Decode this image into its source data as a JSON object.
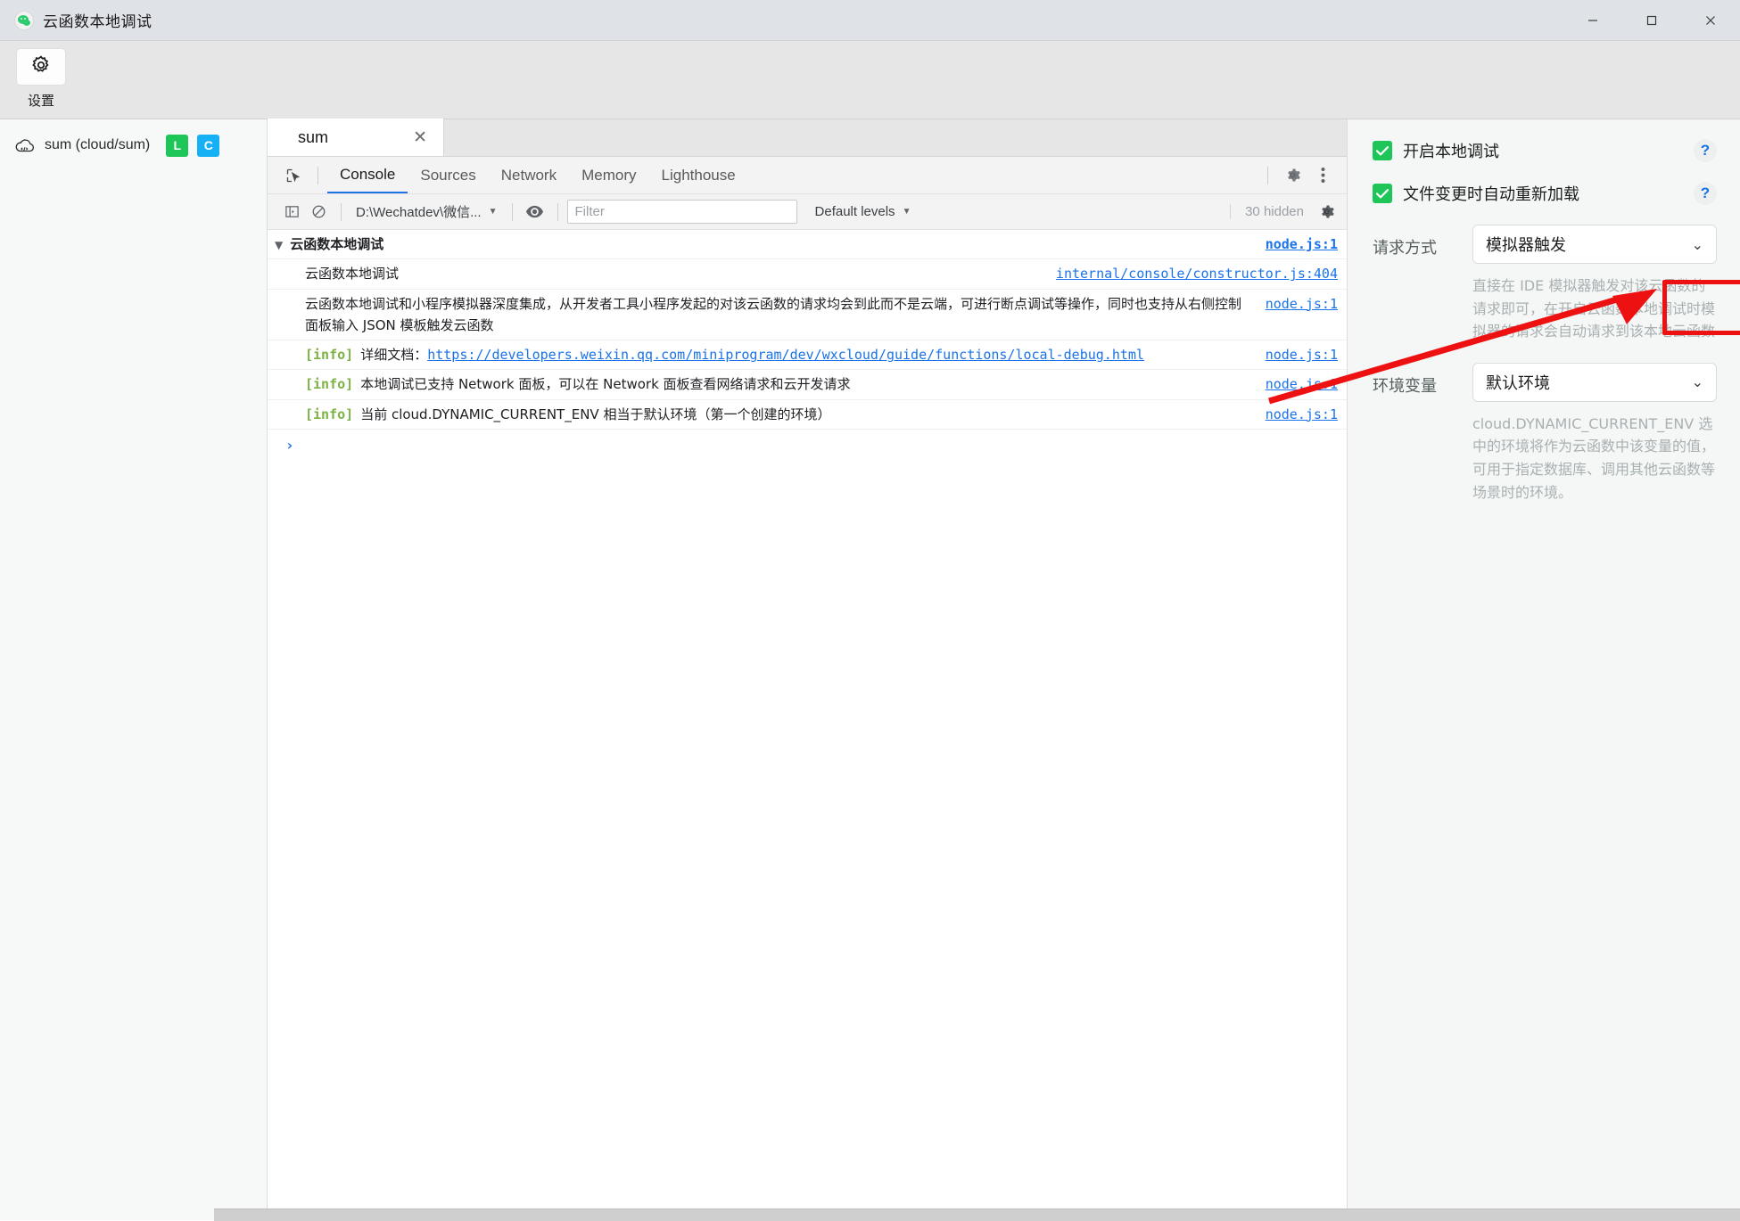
{
  "window": {
    "title": "云函数本地调试",
    "app_icon": "wechat-devtools-icon",
    "minimize": "—",
    "maximize": "□",
    "close": "✕"
  },
  "toolbar": {
    "settings_label": "设置",
    "settings_icon": "gear-icon"
  },
  "sidebar": {
    "items": [
      {
        "icon": "cloud-function-icon",
        "name": "sum (cloud/sum)",
        "badges": [
          {
            "text": "L",
            "color": "#1ec659"
          },
          {
            "text": "C",
            "color": "#16b0f5"
          }
        ]
      }
    ]
  },
  "devtools": {
    "tab": {
      "title": "sum",
      "close": "✕"
    },
    "inspect_icon": "inspect-element-icon",
    "panels": [
      {
        "label": "Console",
        "active": true
      },
      {
        "label": "Sources",
        "active": false
      },
      {
        "label": "Network",
        "active": false
      },
      {
        "label": "Memory",
        "active": false
      },
      {
        "label": "Lighthouse",
        "active": false
      }
    ],
    "settings_icon": "gear-icon",
    "more_icon": "kebab-menu-icon",
    "console_bar": {
      "sidebar_toggle_icon": "console-sidebar-icon",
      "clear_icon": "clear-console-icon",
      "context": "D:\\Wechatdev\\微信...",
      "context_caret": "▼",
      "eye_icon": "live-expression-icon",
      "filter_placeholder": "Filter",
      "filter_value": "",
      "levels": "Default levels",
      "levels_caret": "▼",
      "hidden": "30 hidden",
      "settings_icon": "gear-icon"
    },
    "messages": [
      {
        "type": "group",
        "triangle": "▼",
        "text": "云函数本地调试",
        "source": "node.js:1",
        "source_style": "link"
      },
      {
        "type": "plain",
        "text": "云函数本地调试",
        "source": "internal/console/constructor.js:404",
        "source_style": "link"
      },
      {
        "type": "plain",
        "text": "云函数本地调试和小程序模拟器深度集成，从开发者工具小程序发起的对该云函数的请求均会到此而不是云端，可进行断点调试等操作，同时也支持从右侧控制面板输入 JSON 模板触发云函数",
        "source": "node.js:1",
        "source_style": "link"
      },
      {
        "type": "info",
        "level": "[info]",
        "text": "详细文档：",
        "link": "https://developers.weixin.qq.com/miniprogram/dev/wxcloud/guide/functions/local-debug.html",
        "source": "node.js:1",
        "source_style": "link"
      },
      {
        "type": "info",
        "level": "[info]",
        "text": "本地调试已支持 Network 面板，可以在 Network 面板查看网络请求和云开发请求",
        "source": "node.js:1",
        "source_style": "link"
      },
      {
        "type": "info",
        "level": "[info]",
        "text": "当前 cloud.DYNAMIC_CURRENT_ENV 相当于默认环境（第一个创建的环境）",
        "source": "node.js:1",
        "source_style": "link"
      }
    ],
    "prompt": "›"
  },
  "panel": {
    "checkboxes": [
      {
        "label": "开启本地调试",
        "checked": true,
        "help": "?"
      },
      {
        "label": "文件变更时自动重新加载",
        "checked": true,
        "help": "?"
      }
    ],
    "request_mode": {
      "label": "请求方式",
      "value": "模拟器触发",
      "caret": "⌄",
      "hint": "直接在 IDE 模拟器触发对该云函数的请求即可，在开启云函数本地调试时模拟器的请求会自动请求到该本地云函数"
    },
    "env_var": {
      "label": "环境变量",
      "value": "默认环境",
      "caret": "⌄",
      "hint": "cloud.DYNAMIC_CURRENT_ENV 选中的环境将作为云函数中该变量的值，可用于指定数据库、调用其他云函数等场景时的环境。"
    }
  },
  "annotation": {
    "highlight_color": "#ee1111",
    "shape": "red-rectangle-with-arrow"
  }
}
